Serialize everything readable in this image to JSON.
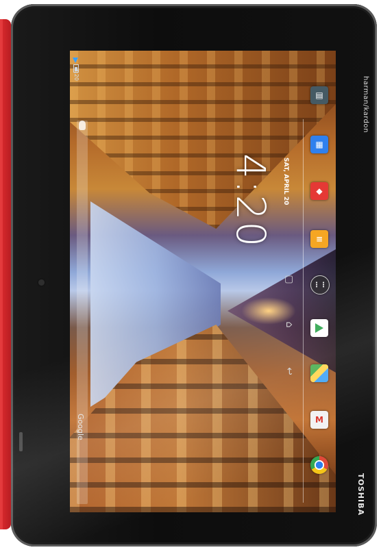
{
  "device": {
    "brand_top": "harman/kardon",
    "brand_bottom": "TOSHIBA"
  },
  "status_bar": {
    "time": "4:20"
  },
  "home": {
    "clock": "4:20",
    "date": "SAT, APRIL 20"
  },
  "search": {
    "label": "Google"
  },
  "dock": {
    "apps": [
      {
        "name": "Chrome",
        "icon": "chrome-icon",
        "color": "#e04a3a"
      },
      {
        "name": "Gmail",
        "icon": "gmail-icon",
        "color": "#f2f2f2"
      },
      {
        "name": "Maps",
        "icon": "maps-icon",
        "color": "#4caf50"
      },
      {
        "name": "Play Store",
        "icon": "play-store-icon",
        "color": "#ffffff"
      },
      {
        "name": "All Apps",
        "icon": "all-apps-icon",
        "color": "#3a3a3a"
      },
      {
        "name": "Notes",
        "icon": "notes-icon",
        "color": "#f5a623"
      },
      {
        "name": "App",
        "icon": "red-app-icon",
        "color": "#e53935"
      },
      {
        "name": "Calendar",
        "icon": "calendar-icon",
        "color": "#2f80ed"
      },
      {
        "name": "Settings",
        "icon": "settings-icon",
        "color": "#455a64"
      }
    ]
  },
  "navigation": {
    "back_icon": "back-icon",
    "home_icon": "home-icon",
    "recent_icon": "recent-apps-icon"
  }
}
